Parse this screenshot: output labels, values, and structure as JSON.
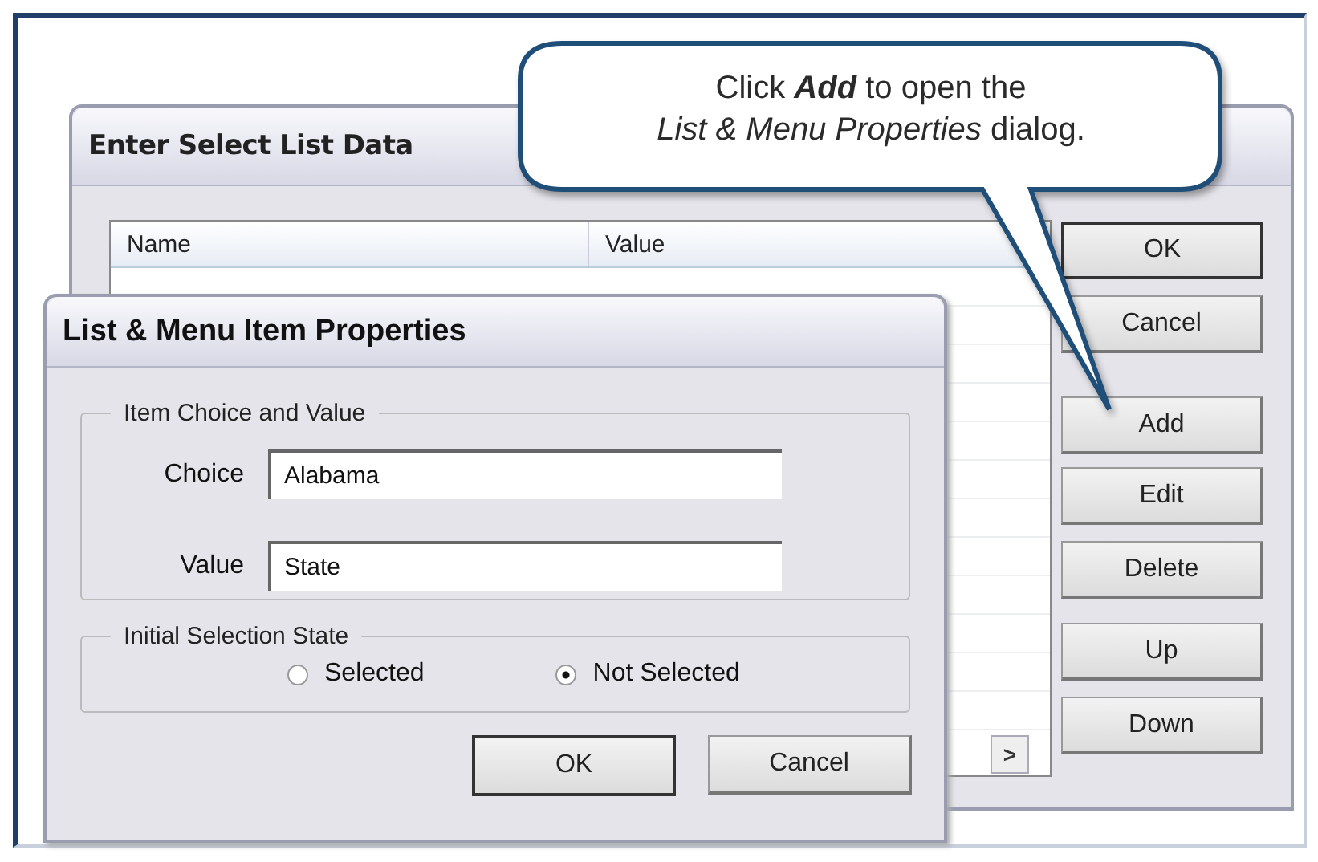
{
  "callout": {
    "lines": [
      "Click **Add** to open the",
      "*List & Menu Properties* dialog."
    ]
  },
  "back_dialog": {
    "title": "Enter Select List Data",
    "table": {
      "columns": [
        "Name",
        "Value"
      ]
    },
    "buttons": [
      {
        "label": "OK",
        "default": true
      },
      {
        "label": "Cancel",
        "default": false
      },
      {
        "label": "Add",
        "default": false
      },
      {
        "label": "Edit",
        "default": false
      },
      {
        "label": "Delete",
        "default": false
      },
      {
        "label": "Up",
        "default": false
      },
      {
        "label": "Down",
        "default": false
      }
    ],
    "scroll_arrow": ">"
  },
  "front_dialog": {
    "title": "List & Menu Item Properties",
    "groups": [
      {
        "legend": "Item Choice and Value",
        "kind": "fields",
        "fields": [
          {
            "label": "Choice",
            "value": "Alabama"
          },
          {
            "label": "Value",
            "value": "State"
          }
        ]
      },
      {
        "legend": "Initial Selection State",
        "kind": "radios",
        "options": [
          {
            "label": "Selected",
            "selected": false
          },
          {
            "label": "Not Selected",
            "selected": true
          }
        ]
      }
    ],
    "buttons": [
      {
        "label": "OK",
        "default": true
      },
      {
        "label": "Cancel",
        "default": false
      }
    ]
  }
}
